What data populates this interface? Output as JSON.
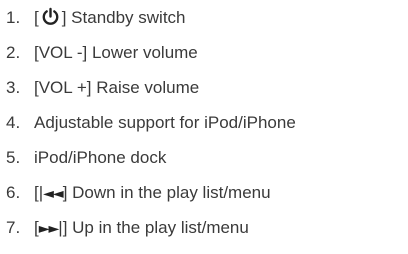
{
  "items": [
    {
      "number": "1.",
      "prefix": "[",
      "suffix": "] Standby switch",
      "icon": "power-icon"
    },
    {
      "number": "2.",
      "label": "[VOL -] Lower volume"
    },
    {
      "number": "3.",
      "label": "[VOL +] Raise volume"
    },
    {
      "number": "4.",
      "label": "Adjustable support for iPod/iPhone"
    },
    {
      "number": "5.",
      "label": "iPod/iPhone dock"
    },
    {
      "number": "6.",
      "prefix": "[|",
      "glyph": "◄◄",
      "suffix": "] Down in the play list/menu",
      "icon": "skip-back-icon"
    },
    {
      "number": "7.",
      "prefix": "[",
      "glyph": "►►",
      "suffix": "|] Up in the play list/menu",
      "icon": "skip-forward-icon"
    }
  ],
  "colors": {
    "text": "#3a3a3a",
    "icon": "#222222"
  }
}
